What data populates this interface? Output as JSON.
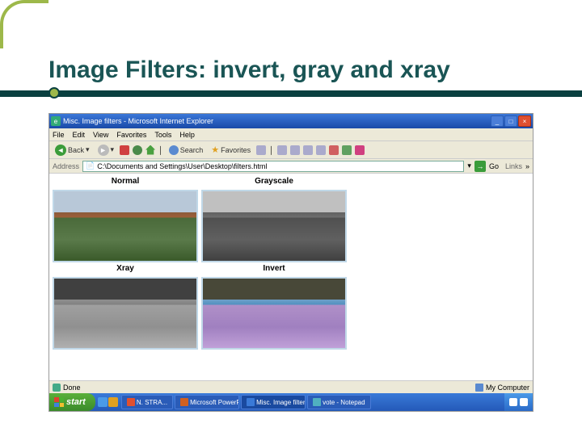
{
  "slide": {
    "title": "Image Filters: invert, gray and xray"
  },
  "window": {
    "title": "Misc. Image filters - Microsoft Internet Explorer",
    "min": "_",
    "max": "□",
    "close": "×"
  },
  "menu": {
    "file": "File",
    "edit": "Edit",
    "view": "View",
    "favorites": "Favorites",
    "tools": "Tools",
    "help": "Help"
  },
  "toolbar": {
    "back": "Back",
    "search": "Search",
    "favorites": "Favorites"
  },
  "address": {
    "label": "Address",
    "value": "C:\\Documents and Settings\\User\\Desktop\\filters.html",
    "go": "Go",
    "links": "Links"
  },
  "content": {
    "label_normal": "Normal",
    "label_grayscale": "Grayscale",
    "label_xray": "Xray",
    "label_invert": "Invert"
  },
  "status": {
    "done": "Done",
    "zone": "My Computer"
  },
  "taskbar": {
    "start": "start",
    "items": [
      {
        "label": "N. STRA...",
        "color": "#e05030"
      },
      {
        "label": "Microsoft PowerP...",
        "color": "#d06020"
      },
      {
        "label": "Misc. Image filters...",
        "color": "#3a7ad8"
      },
      {
        "label": "vote - Notepad",
        "color": "#50b0c0"
      }
    ]
  }
}
